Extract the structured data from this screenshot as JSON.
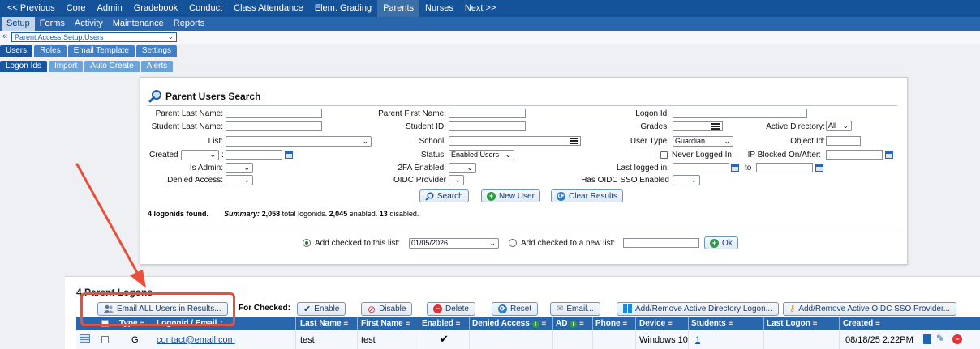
{
  "topnav": {
    "items": [
      "<< Previous",
      "Core",
      "Admin",
      "Gradebook",
      "Conduct",
      "Class Attendance",
      "Elem. Grading",
      "Parents",
      "Nurses",
      "Next >>"
    ],
    "active_index": 7
  },
  "subnav": {
    "items": [
      "Setup",
      "Forms",
      "Activity",
      "Maintenance",
      "Reports"
    ],
    "active_index": 0
  },
  "breadcrumb": {
    "value": "Parent Access.Setup.Users"
  },
  "tabs1": [
    "Users",
    "Roles",
    "Email Template",
    "Settings"
  ],
  "tabs2": [
    "Logon Ids",
    "Import",
    "Auto Create",
    "Alerts"
  ],
  "search": {
    "title": "Parent Users Search",
    "labels": {
      "parent_last": "Parent Last Name:",
      "parent_first": "Parent First Name:",
      "logon_id": "Logon Id:",
      "student_last": "Student Last Name:",
      "student_id": "Student ID:",
      "grades": "Grades:",
      "active_directory": "Active Directory:",
      "list": "List:",
      "school": "School:",
      "user_type": "User Type:",
      "object_id": "Object Id:",
      "created": "Created",
      "status": "Status:",
      "never_logged": "Never Logged In",
      "ip_blocked": "IP Blocked On/After:",
      "is_admin": "Is Admin:",
      "twofa": "2FA Enabled:",
      "last_logged": "Last logged in:",
      "to": "to",
      "denied": "Denied Access:",
      "oidc": "OIDC Provider",
      "has_oidc": "Has OIDC SSO Enabled"
    },
    "values": {
      "active_directory": "All",
      "status": "Enabled Users",
      "user_type": "Guardian",
      "created_sep": ":"
    },
    "buttons": {
      "search": "Search",
      "new_user": "New User",
      "clear": "Clear Results"
    },
    "found": {
      "count": "4 logonids found.",
      "summary_label": "Summary:",
      "total": "2,058",
      "total_text": "total logonids.",
      "enabled": "2,045",
      "enabled_text": "enabled.",
      "disabled": "13",
      "disabled_text": "disabled."
    },
    "add_list": {
      "label": "Add checked to this list:",
      "date": "01/05/2026",
      "new_label": "Add checked to a new list:",
      "ok": "Ok"
    }
  },
  "results": {
    "title": "4 Parent Logons",
    "email_all": "Email ALL Users in Results...",
    "for_checked": "For Checked:",
    "actions": [
      "Enable",
      "Disable",
      "Delete",
      "Reset",
      "Email...",
      "Add/Remove Active Directory Logon...",
      "Add/Remove Active OIDC SSO Provider..."
    ],
    "columns": [
      "Type",
      "Logonid / Email",
      "Last Name",
      "First Name",
      "Enabled",
      "Denied Access",
      "AD",
      "Phone",
      "Device",
      "Students",
      "Last Logon",
      "Created"
    ],
    "row": {
      "type": "G",
      "email": "contact@email.com",
      "last": "test",
      "first": "test",
      "enabled": "✔",
      "device": "Windows 10",
      "students": "1",
      "created": "08/18/25 2:22PM"
    }
  }
}
